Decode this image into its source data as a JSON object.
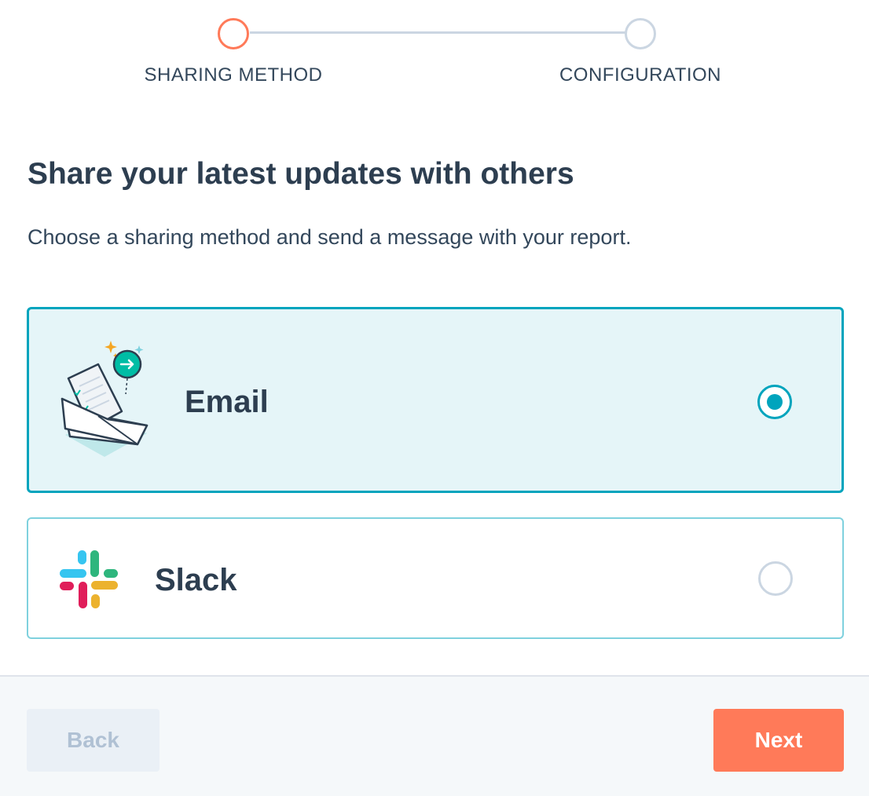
{
  "stepper": {
    "steps": [
      {
        "label": "SHARING METHOD",
        "state": "active"
      },
      {
        "label": "CONFIGURATION",
        "state": "inactive"
      }
    ]
  },
  "heading": {
    "title": "Share your latest updates with others",
    "subtitle": "Choose a sharing method and send a message with your report."
  },
  "options": [
    {
      "label": "Email",
      "icon": "email-illustration-icon",
      "selected": true
    },
    {
      "label": "Slack",
      "icon": "slack-logo-icon",
      "selected": false
    }
  ],
  "footer": {
    "back_label": "Back",
    "next_label": "Next"
  },
  "colors": {
    "accent": "#00a4bd",
    "primary_button": "#ff7a59",
    "active_step": "#ff7a59",
    "inactive": "#cbd6e2",
    "selected_bg": "#e5f5f8"
  }
}
